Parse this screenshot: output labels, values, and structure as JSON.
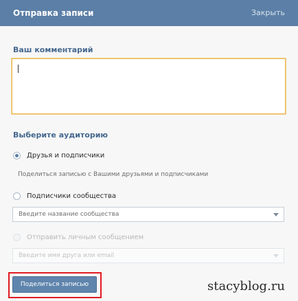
{
  "header": {
    "title": "Отправка записи",
    "close_label": "Закрыть"
  },
  "comment": {
    "label": "Ваш комментарий",
    "value": ""
  },
  "audience": {
    "label": "Выберите аудиторию",
    "friends_label": "Друзья и подписчики",
    "friends_hint": "Поделиться записью с Вашими друзьями и подписчиками",
    "community_label": "Подписчики сообщества",
    "community_placeholder": "Введите название сообщества",
    "private_label": "Отправить личным сообщением",
    "private_placeholder": "Введите имя друга или email",
    "selected": "friends"
  },
  "actions": {
    "share_label": "Поделиться записью"
  },
  "watermark": {
    "text": "stacyblog.ru"
  },
  "colors": {
    "header": "#5b7fa6",
    "accent": "#45688e",
    "focus_border": "#e8b851",
    "highlight": "#e01b22"
  }
}
